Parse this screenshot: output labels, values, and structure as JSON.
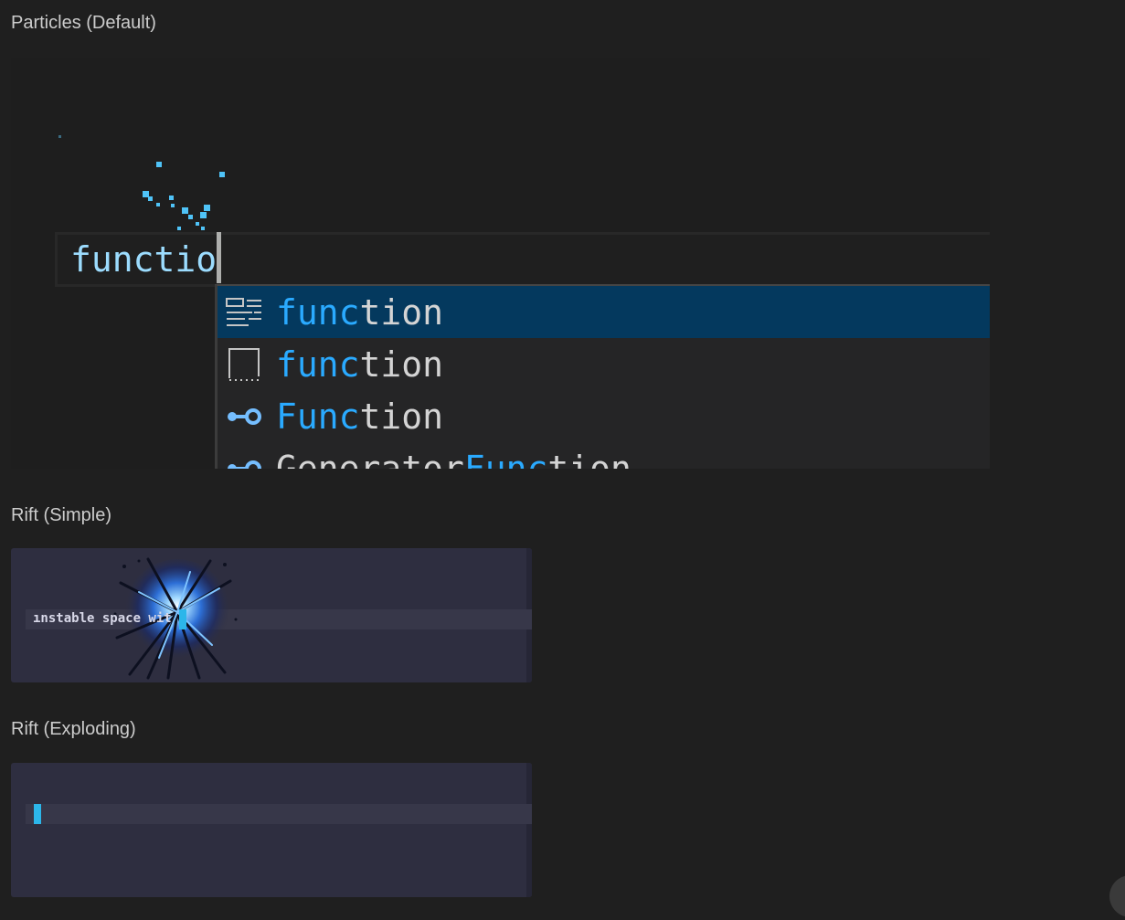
{
  "sections": {
    "particles_title": "Particles (Default)",
    "rift_simple_title": "Rift (Simple)",
    "rift_exploding_title": "Rift (Exploding)"
  },
  "particles": {
    "typed_text": "functio",
    "suggestions": [
      {
        "icon": "keyword-icon",
        "highlight": "func",
        "rest": "tion",
        "selected": true
      },
      {
        "icon": "snippet-icon",
        "highlight": "func",
        "rest": "tion",
        "selected": false
      },
      {
        "icon": "class-icon",
        "highlight": "Func",
        "rest": "tion",
        "selected": false
      },
      {
        "icon": "class-icon",
        "prefix": "Generator",
        "highlight": "Func",
        "rest": "tion",
        "selected": false
      }
    ]
  },
  "rift_simple": {
    "text": "ınstable space wit"
  },
  "colors": {
    "background": "#1f1f1f",
    "accent": "#2aaaff",
    "selection": "#04395e",
    "cursor": "#2cb6ea"
  }
}
